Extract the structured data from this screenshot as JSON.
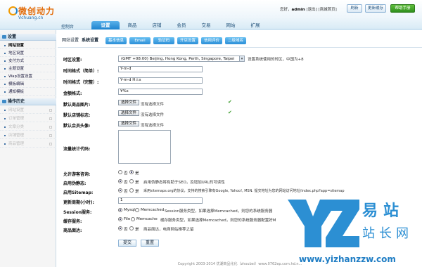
{
  "brand": {
    "logo_text": "微创动力",
    "logo_sub": "Vchuang.cn",
    "tagline": "控制台"
  },
  "user_info": {
    "greeting": "您好，",
    "username": "admin",
    "links": "[退出] [商城首页]"
  },
  "toolbar": {
    "refresh": "刷新",
    "update_cache": "更新缓存",
    "help": "帮助手册"
  },
  "nav_tabs": [
    "设置",
    "商品",
    "店铺",
    "会员",
    "交易",
    "网站",
    "扩展"
  ],
  "nav_active": "设置",
  "sidebar": {
    "section1": "设置",
    "items": [
      "网站设置",
      "地区设置",
      "支付方式",
      "主题设置",
      "Wap设置设置",
      "模板编辑",
      "通知模板"
    ],
    "section2": "操作历史",
    "history": [
      "网站设置",
      "订单管理",
      "文章分类",
      "店铺管理",
      "商品管理"
    ]
  },
  "subnav": {
    "label": "网站设置",
    "sub_label": "系统设置",
    "tabs": [
      "基本信息",
      "Email",
      "验证码",
      "开店设置",
      "信用评价",
      "二级域名"
    ]
  },
  "form": {
    "timezone": {
      "label": "时区设置:",
      "value": "(GMT +08:00) Beijing, Hong Kong, Perth, Singapore, Taipei",
      "hint": "设置系统使用的时区，中国为+8"
    },
    "date_format": {
      "label": "时间格式（简单）:",
      "value": "Y-m-d"
    },
    "datetime_format": {
      "label": "时间格式（完整）:",
      "value": "Y-m-d H:i:s"
    },
    "currency_format": {
      "label": "金额格式:",
      "value": "¥%s"
    },
    "default_goods_image": {
      "label": "默认商品图片:",
      "button": "选择文件",
      "hint": "没有选择文件"
    },
    "default_store_logo": {
      "label": "默认店铺标志:",
      "button": "选择文件",
      "hint": "没有选择文件"
    },
    "default_avatar": {
      "label": "默认会员头像:",
      "button": "选择文件",
      "hint": "没有选择文件"
    },
    "stats_code": {
      "label": "流量统计代码:"
    },
    "guest_consult": {
      "label": "允许游客咨询:",
      "yes": "否",
      "no": "是"
    },
    "pseudo_static": {
      "label": "启用伪静态:",
      "yes": "否",
      "no": "是",
      "hint": "启用伪静态将有助于SEO，及增加URL的可读性"
    },
    "sitemap": {
      "label": "启用Sitemap:",
      "yes": "否",
      "no": "是",
      "hint": "采用sitemaps.org的协议，支持的搜索引擎有Google, Yahoo!, MSN. 提交地址为您的网站访问地址/index.php?app=sitemap"
    },
    "update_period": {
      "label": "更新周期(小时):",
      "value": "1"
    },
    "session": {
      "label": "Session服务:",
      "opt1": "Mysql",
      "opt2": "Memcached",
      "hint": "Session服务类型，如果选择Memcached，则您的系统服务器"
    },
    "cache": {
      "label": "缓存服务:",
      "opt1": "File",
      "opt2": "Memcache",
      "hint": "缓存服务类型，如果选择Memcached，则您的系统服务器配置好M"
    },
    "close_site": {
      "label": "商品面达:",
      "opt1": "否",
      "opt2": "是",
      "hint": "商品面达，电商网站推荐之留"
    },
    "submit": "提交",
    "reset": "重置"
  },
  "footer": "Copyright 2003-2014 优潮商品化化（zhoubei）www.0762ep.com.hd.n...",
  "watermark": {
    "chars_top": "易站",
    "chars_bottom": "站长网",
    "url": "www.yizhanzzw.com"
  },
  "colors": {
    "accent": "#1d83cf",
    "check": "#3a9c2a"
  }
}
